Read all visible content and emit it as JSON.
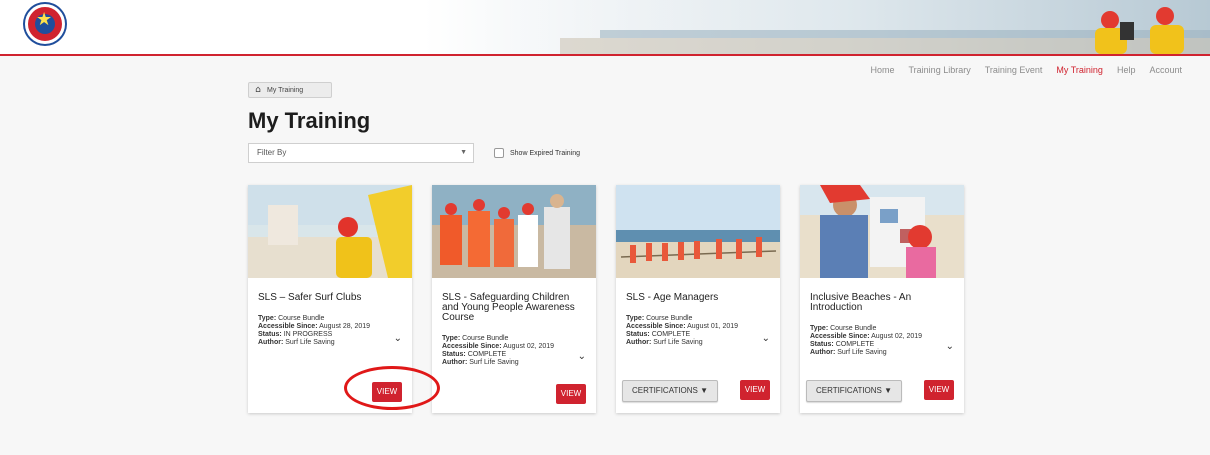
{
  "nav": {
    "items": [
      "Home",
      "Training Library",
      "Training Event",
      "My Training",
      "Help",
      "Account"
    ],
    "active": "My Training"
  },
  "breadcrumb": {
    "label": "My Training"
  },
  "page": {
    "title": "My Training"
  },
  "filter": {
    "placeholder": "Filter By"
  },
  "show_expired": {
    "label": "Show Expired Training"
  },
  "labels": {
    "type": "Type:",
    "since": "Accessible Since:",
    "status": "Status:",
    "author": "Author:"
  },
  "cards": [
    {
      "title": "SLS – Safer Surf Clubs",
      "type": "Course Bundle",
      "since": "August 28, 2019",
      "status": "IN PROGRESS",
      "author": "Surf Life Saving",
      "view": "VIEW"
    },
    {
      "title": "SLS - Safeguarding Children and Young People Awareness Course",
      "type": "Course Bundle",
      "since": "August 02, 2019",
      "status": "COMPLETE",
      "author": "Surf Life Saving",
      "view": "VIEW"
    },
    {
      "title": "SLS - Age Managers",
      "type": "Course Bundle",
      "since": "August 01, 2019",
      "status": "COMPLETE",
      "author": "Surf Life Saving",
      "view": "VIEW",
      "cert": "CERTIFICATIONS ▼"
    },
    {
      "title": "Inclusive Beaches - An Introduction",
      "type": "Course Bundle",
      "since": "August 02, 2019",
      "status": "COMPLETE",
      "author": "Surf Life Saving",
      "view": "VIEW",
      "cert": "CERTIFICATIONS ▼"
    }
  ],
  "colors": {
    "brand_red": "#d0232f",
    "navy": "#1f4e9c",
    "nav_gray": "#8c8c8c"
  }
}
